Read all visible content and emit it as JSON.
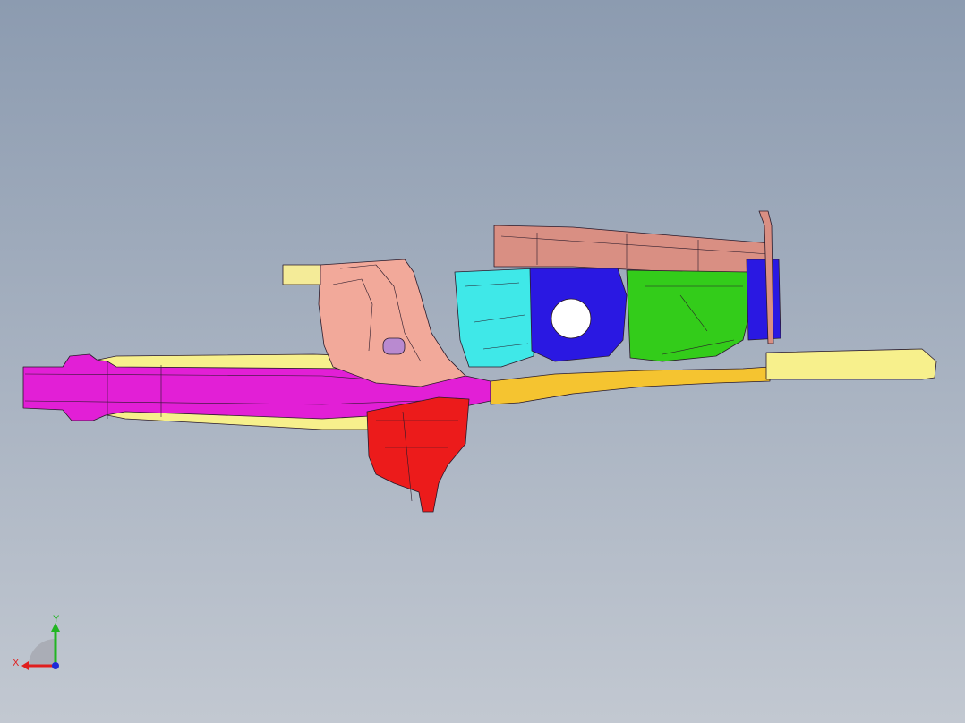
{
  "viewport": {
    "background_top": "#8c9bb0",
    "background_bottom": "#c2c8d1"
  },
  "model": {
    "colors": {
      "rail_magenta": "#e21fd6",
      "rail_light_yellow": "#f7f08c",
      "bracket_salmon": "#f2a99a",
      "mount_red": "#ec1b1b",
      "cover_rosy": "#d98f83",
      "panel_cyan": "#3fe8e8",
      "mount_blue": "#2a18e2",
      "panel_green": "#33cc1a",
      "rail_gold": "#f5c430",
      "tab_cream": "#f4eb98",
      "edge_dark": "#2a1a2a"
    }
  },
  "triad": {
    "x_label": "X",
    "y_label": "Y",
    "x_color": "#e01e1e",
    "y_color": "#22b522",
    "z_color": "#1d2ad8"
  }
}
